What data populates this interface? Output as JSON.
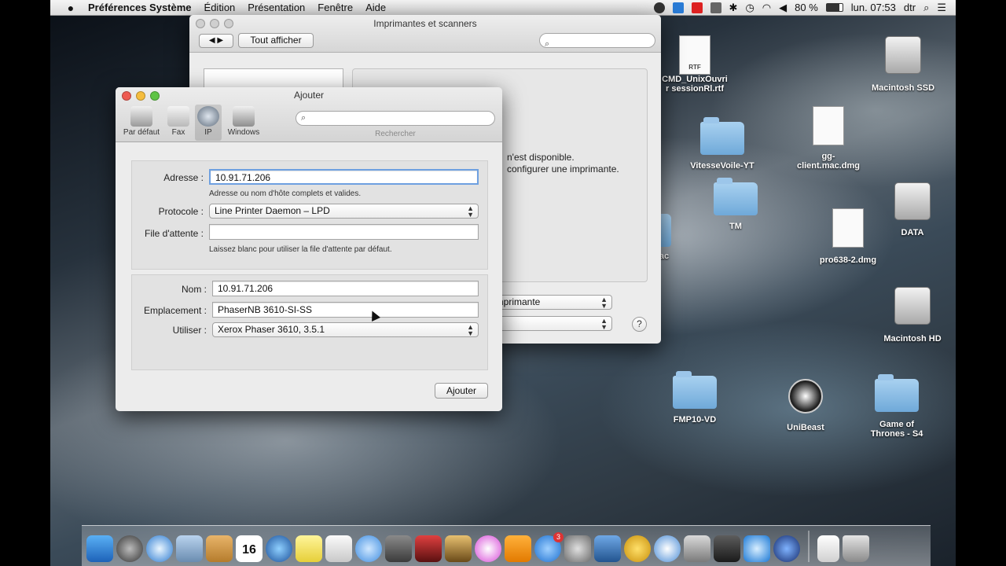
{
  "menubar": {
    "app_name": "Préférences Système",
    "items": [
      "Édition",
      "Présentation",
      "Fenêtre",
      "Aide"
    ],
    "battery": "80 %",
    "clock": "lun. 07:53",
    "user": "dtr"
  },
  "bg_window": {
    "title": "Imprimantes et scanners",
    "show_all": "Tout afficher",
    "message_line1": "n'est disponible.",
    "message_line2": "configurer une imprimante.",
    "popup1": "imprimante",
    "help": "?"
  },
  "add_dialog": {
    "title": "Ajouter",
    "toolbar": [
      {
        "label": "Par défaut",
        "icon": "printer-icon"
      },
      {
        "label": "Fax",
        "icon": "fax-icon"
      },
      {
        "label": "IP",
        "icon": "globe-icon"
      },
      {
        "label": "Windows",
        "icon": "windows-printer-icon"
      }
    ],
    "search_label": "Rechercher",
    "address_label": "Adresse :",
    "address_value": "10.91.71.206",
    "address_hint": "Adresse ou nom d'hôte complets et valides.",
    "protocol_label": "Protocole :",
    "protocol_value": "Line Printer Daemon – LPD",
    "queue_label": "File d'attente :",
    "queue_value": "",
    "queue_hint": "Laissez blanc pour utiliser la file d'attente par défaut.",
    "name_label": "Nom :",
    "name_value": "10.91.71.206",
    "location_label": "Emplacement :",
    "location_value": "PhaserNB 3610-SI-SS",
    "use_label": "Utiliser :",
    "use_value": "Xerox Phaser 3610, 3.5.1",
    "add_button": "Ajouter"
  },
  "desktop": {
    "rtf_label": "RTF",
    "rtf_name_1": "CMD_UnixOuvri",
    "rtf_name_2": "r sessionRl.rtf",
    "macintosh_ssd": "Macintosh SSD",
    "vitesse": "VitesseVoile-YT",
    "gg_1": "gg-",
    "gg_2": "client.mac.dmg",
    "tm": "TM",
    "data": "DATA",
    "osmac": "osMac",
    "pro638": "pro638-2.dmg",
    "macintosh_hd": "Macintosh HD",
    "fmp": "FMP10-VD",
    "unibeast": "UniBeast",
    "got_1": "Game of",
    "got_2": "Thrones - S4"
  },
  "dock": {
    "calendar_day": "16",
    "appstore_badge": "3"
  }
}
